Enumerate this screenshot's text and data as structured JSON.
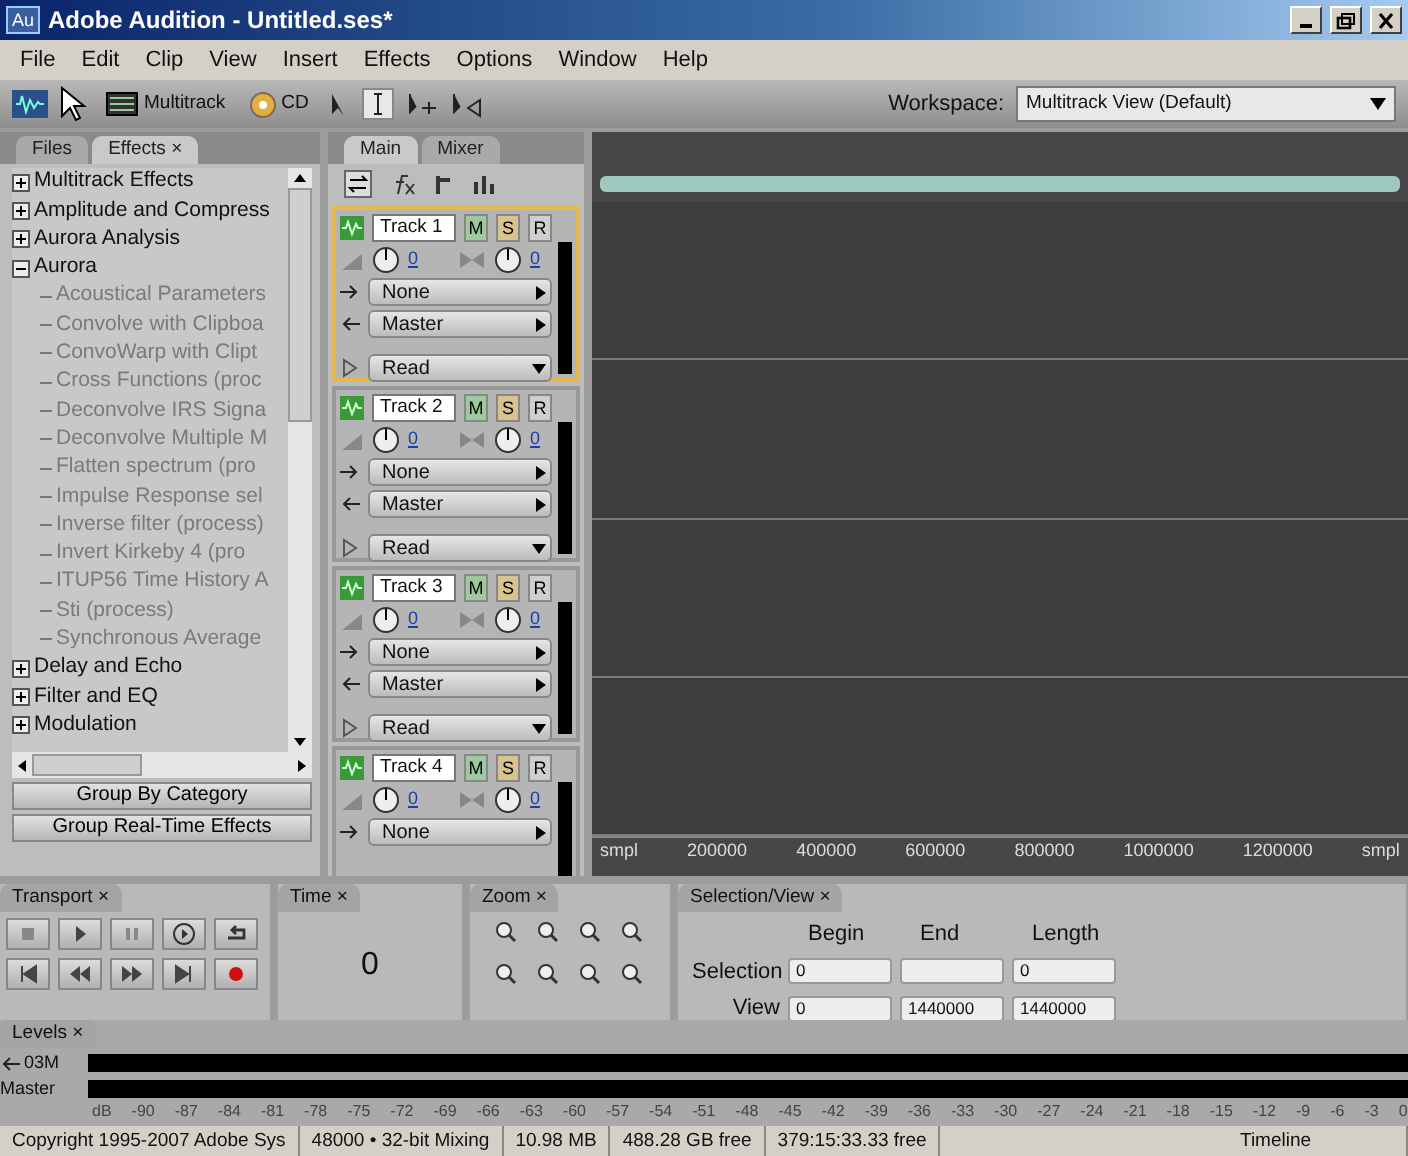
{
  "window": {
    "app_icon": "Au",
    "title": "Adobe Audition - Untitled.ses*"
  },
  "menu": [
    "File",
    "Edit",
    "Clip",
    "View",
    "Insert",
    "Effects",
    "Options",
    "Window",
    "Help"
  ],
  "toolbar": {
    "multitrack_label": "Multitrack",
    "cd_label": "CD",
    "workspace_label": "Workspace:",
    "workspace_value": "Multitrack View (Default)"
  },
  "effects_panel": {
    "tabs": [
      {
        "label": "Files",
        "selected": false
      },
      {
        "label": "Effects",
        "selected": true,
        "close": "×"
      }
    ],
    "tree": [
      {
        "label": "Multitrack Effects",
        "expanded": false
      },
      {
        "label": "Amplitude and Compress",
        "expanded": false
      },
      {
        "label": "Aurora Analysis",
        "expanded": false
      },
      {
        "label": "Aurora",
        "expanded": true,
        "children": [
          {
            "label": "Acoustical Parameters",
            "disabled": true
          },
          {
            "label": "Convolve with Clipboa",
            "disabled": true
          },
          {
            "label": "ConvoWarp with Clipt",
            "disabled": true
          },
          {
            "label": "Cross Functions (proc",
            "disabled": true
          },
          {
            "label": "Deconvolve IRS Signa",
            "disabled": true
          },
          {
            "label": "Deconvolve Multiple M",
            "disabled": true
          },
          {
            "label": "Flatten spectrum (pro",
            "disabled": true
          },
          {
            "label": "Impulse Response sel",
            "disabled": true
          },
          {
            "label": "Inverse filter (process)",
            "disabled": true
          },
          {
            "label": "Invert Kirkeby 4  (pro",
            "disabled": true
          },
          {
            "label": "ITUP56 Time History A",
            "disabled": true
          },
          {
            "label": "Sti (process)",
            "disabled": true
          },
          {
            "label": "Synchronous Average",
            "disabled": true
          }
        ]
      },
      {
        "label": "Delay and Echo",
        "expanded": false
      },
      {
        "label": "Filter and EQ",
        "expanded": false
      },
      {
        "label": "Modulation",
        "expanded": false
      }
    ],
    "buttons": [
      "Group By Category",
      "Group Real-Time Effects"
    ]
  },
  "tracks_panel": {
    "tabs": [
      {
        "label": "Main",
        "selected": true
      },
      {
        "label": "Mixer",
        "selected": false
      }
    ],
    "tracks": [
      {
        "name": "Track 1",
        "selected": true,
        "buttons": [
          "M",
          "S",
          "R"
        ],
        "volume": "0",
        "pan": "0",
        "output": [
          "None",
          "Master"
        ],
        "automation": "Read"
      },
      {
        "name": "Track 2",
        "selected": false,
        "buttons": [
          "M",
          "S",
          "R"
        ],
        "volume": "0",
        "pan": "0",
        "output": [
          "None",
          "Master"
        ],
        "automation": "Read"
      },
      {
        "name": "Track 3",
        "selected": false,
        "buttons": [
          "M",
          "S",
          "R"
        ],
        "volume": "0",
        "pan": "0",
        "output": [
          "None",
          "Master"
        ],
        "automation": "Read"
      },
      {
        "name": "Track 4",
        "selected": false,
        "buttons": [
          "M",
          "S",
          "R"
        ],
        "volume": "0",
        "pan": "0",
        "output": [
          "None"
        ]
      }
    ]
  },
  "timeline": {
    "ruler": [
      "smpl",
      "200000",
      "400000",
      "600000",
      "800000",
      "1000000",
      "1200000",
      "smpl"
    ]
  },
  "transport": {
    "title": "Transport",
    "close": "×"
  },
  "time": {
    "title": "Time",
    "close": "×",
    "value": "0"
  },
  "zoom": {
    "title": "Zoom",
    "close": "×"
  },
  "selection_view": {
    "title": "Selection/View",
    "close": "×",
    "columns": [
      "Begin",
      "End",
      "Length"
    ],
    "rows": [
      {
        "label": "Selection",
        "begin": "0",
        "length": "0"
      },
      {
        "label": "View",
        "begin": "0",
        "end": "1440000",
        "length": "1440000"
      }
    ]
  },
  "levels": {
    "title": "Levels",
    "close": "×",
    "channels": [
      "03M",
      "Master"
    ],
    "scale": [
      "dB",
      "-90",
      "-87",
      "-84",
      "-81",
      "-78",
      "-75",
      "-72",
      "-69",
      "-66",
      "-63",
      "-60",
      "-57",
      "-54",
      "-51",
      "-48",
      "-45",
      "-42",
      "-39",
      "-36",
      "-33",
      "-30",
      "-27",
      "-24",
      "-21",
      "-18",
      "-15",
      "-12",
      "-9",
      "-6",
      "-3",
      "0"
    ]
  },
  "status_bar": [
    "Copyright 1995-2007 Adobe Sys",
    "48000 • 32-bit Mixing",
    "10.98 MB",
    "488.28 GB free",
    "379:15:33.33 free",
    "Timeline"
  ]
}
